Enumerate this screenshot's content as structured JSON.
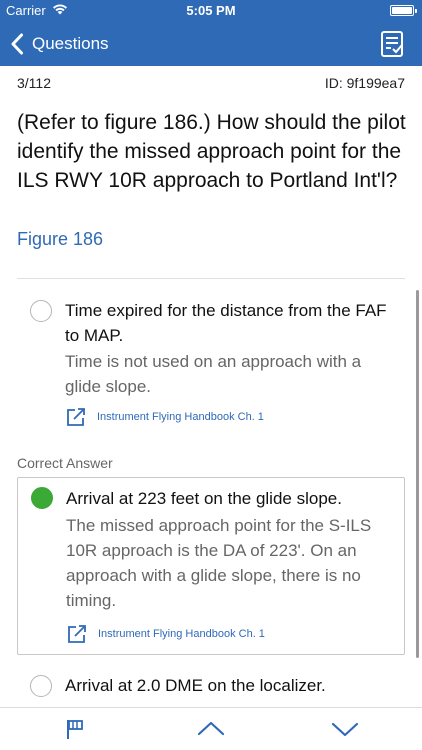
{
  "status_bar": {
    "carrier": "Carrier",
    "time": "5:05 PM"
  },
  "nav": {
    "back_label": "Questions",
    "back_icon": "chevron-left-icon",
    "right_icon": "checklist-icon"
  },
  "question": {
    "counter": "3/112",
    "id": "ID: 9f199ea7",
    "text": "(Refer to figure 186.) How should the pilot identify the missed approach point for the ILS RWY 10R approach to Portland Int'l?",
    "figure_link": "Figure 186"
  },
  "options": [
    {
      "answer": "Time expired for the distance from the FAF to MAP.",
      "explanation": "Time is not used on an approach with a glide slope.",
      "reference": "Instrument Flying Handbook Ch. 1",
      "selected": false
    },
    {
      "answer": "Arrival at 223 feet on the glide slope.",
      "explanation": "The missed approach point for the S-ILS 10R approach is the DA of 223'.  On an approach with a glide slope, there is no timing.",
      "reference": "Instrument Flying Handbook Ch. 1",
      "selected": true
    },
    {
      "answer": "Arrival at 2.0 DME on the localizer.",
      "selected": false
    }
  ],
  "correct_answer_label": "Correct Answer",
  "colors": {
    "brand_blue": "#2f6ab7",
    "correct_green": "#3aa935"
  },
  "toolbar": {
    "icons": [
      "flag-icon",
      "chevron-up-icon",
      "chevron-down-icon"
    ]
  }
}
